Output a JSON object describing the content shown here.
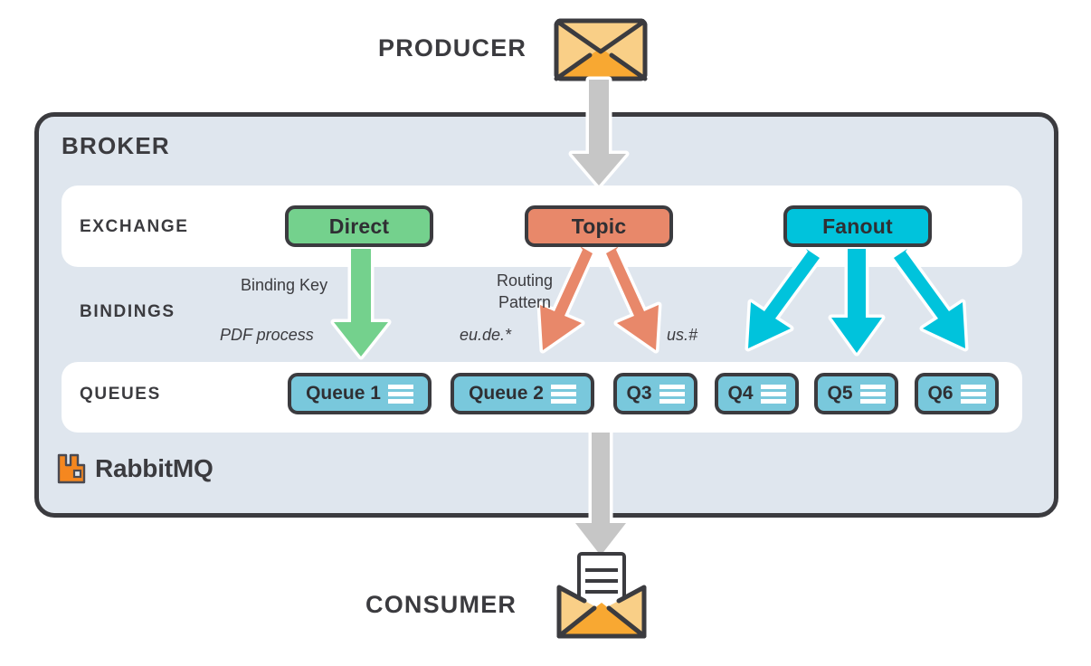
{
  "producer": {
    "label": "PRODUCER",
    "icon": "envelope-icon"
  },
  "consumer": {
    "label": "CONSUMER",
    "icon": "open-envelope-with-letter-icon"
  },
  "broker": {
    "title": "BROKER",
    "brand": "RabbitMQ",
    "brand_icon": "rabbitmq-logo-icon",
    "rows": {
      "exchange_label": "EXCHANGE",
      "bindings_label": "BINDINGS",
      "queues_label": "QUEUES"
    }
  },
  "exchanges": [
    {
      "name": "Direct",
      "color": "#74d18d"
    },
    {
      "name": "Topic",
      "color": "#e8886a"
    },
    {
      "name": "Fanout",
      "color": "#00c3dc"
    }
  ],
  "bindings": {
    "direct": {
      "kind_label": "Binding Key",
      "value": "PDF process"
    },
    "topic": {
      "kind_label": "Routing\nPattern",
      "kind_label_line1": "Routing",
      "kind_label_line2": "Pattern",
      "left_value": "eu.de.*",
      "right_value": "us.#"
    }
  },
  "queues": [
    {
      "name": "Queue 1"
    },
    {
      "name": "Queue 2"
    },
    {
      "name": "Q3"
    },
    {
      "name": "Q4"
    },
    {
      "name": "Q5"
    },
    {
      "name": "Q6"
    }
  ],
  "colors": {
    "ink": "#3b3b3f",
    "broker_bg": "#dfe6ee",
    "panel_bg": "#ffffff",
    "green": "#74d18d",
    "salmon": "#e8886a",
    "cyan": "#00c3dc",
    "queue_blue": "#79c8dc",
    "gray_arrow": "#c6c6c6",
    "envelope_light": "#f9cf87",
    "envelope_dark": "#f8a832",
    "logo_orange": "#f5871f"
  },
  "arrows": [
    {
      "name": "producer-to-topic",
      "color": "#c6c6c6"
    },
    {
      "name": "direct-to-queue-1",
      "color": "#74d18d"
    },
    {
      "name": "topic-to-queue-2",
      "color": "#e8886a"
    },
    {
      "name": "topic-to-q3",
      "color": "#e8886a"
    },
    {
      "name": "fanout-to-q4",
      "color": "#00c3dc"
    },
    {
      "name": "fanout-to-q5",
      "color": "#00c3dc"
    },
    {
      "name": "fanout-to-q6",
      "color": "#00c3dc"
    },
    {
      "name": "queues-to-consumer",
      "color": "#c6c6c6"
    }
  ]
}
